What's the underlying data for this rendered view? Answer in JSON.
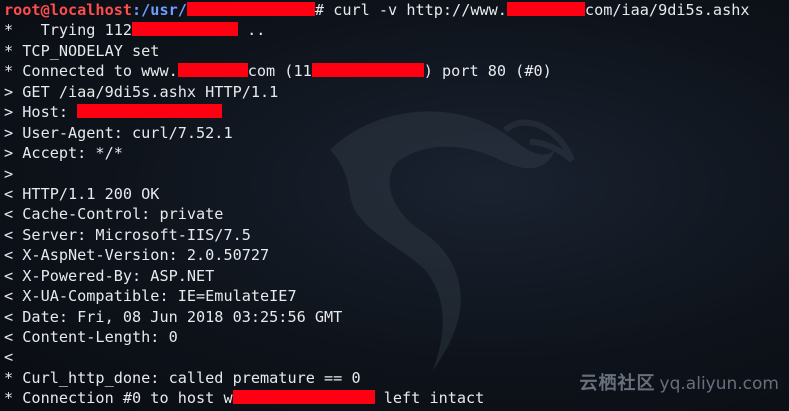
{
  "terminal": {
    "prompt": {
      "user_host": "root@localhost",
      "path_prefix": ":/usr/",
      "hash": "#",
      "command": " curl -v http://www.",
      "command_tail": "com/iaa/9di5s.ashx"
    },
    "lines": [
      {
        "pre": "*   Trying 112",
        "post": " .."
      },
      {
        "text": "* TCP_NODELAY set"
      },
      {
        "pre": "* Connected to www.",
        "mid": "com (11",
        "post": ") port 80 (#0)"
      },
      {
        "text": "> GET /iaa/9di5s.ashx HTTP/1.1"
      },
      {
        "pre": "> Host: ",
        "post": ""
      },
      {
        "text": "> User-Agent: curl/7.52.1"
      },
      {
        "text": "> Accept: */*"
      },
      {
        "text": ">"
      },
      {
        "text": "< HTTP/1.1 200 OK"
      },
      {
        "text": "< Cache-Control: private"
      },
      {
        "text": "< Server: Microsoft-IIS/7.5"
      },
      {
        "text": "< X-AspNet-Version: 2.0.50727"
      },
      {
        "text": "< X-Powered-By: ASP.NET"
      },
      {
        "text": "< X-UA-Compatible: IE=EmulateIE7"
      },
      {
        "text": "< Date: Fri, 08 Jun 2018 03:25:56 GMT"
      },
      {
        "text": "< Content-Length: 0"
      },
      {
        "text": "<"
      },
      {
        "text": "* Curl_http_done: called premature == 0"
      },
      {
        "pre": "* Connection #0 to host w",
        "post": " left intact"
      }
    ]
  },
  "watermark": {
    "brand": "云栖社区",
    "url": "yq.aliyun.com"
  },
  "colors": {
    "redaction": "#ff0013",
    "prompt_user": "#ff4d4d",
    "prompt_path": "#6f9cff"
  }
}
